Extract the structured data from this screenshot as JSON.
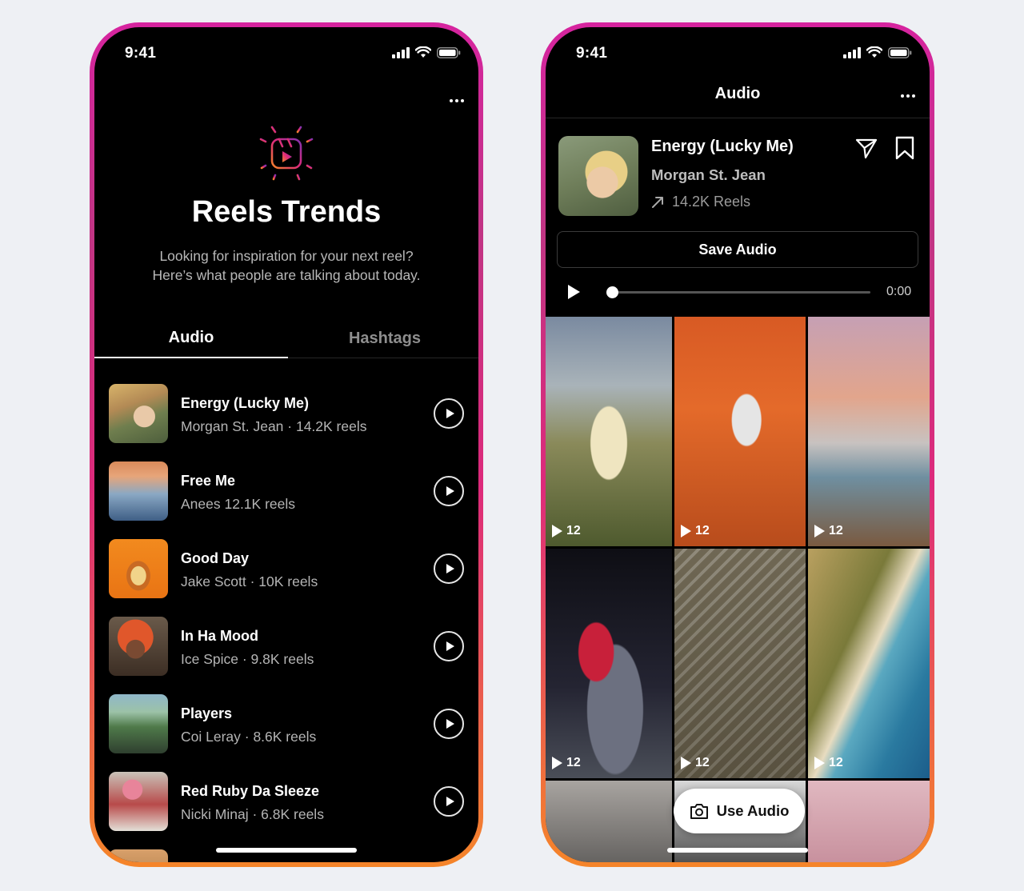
{
  "left_phone": {
    "status_time": "9:41",
    "title": "Reels Trends",
    "subtitle_line1": "Looking for inspiration for your next reel?",
    "subtitle_line2": "Here’s what people are talking about today.",
    "tabs": [
      {
        "label": "Audio",
        "active": true
      },
      {
        "label": "Hashtags",
        "active": false
      }
    ],
    "tracks": [
      {
        "title": "Energy (Lucky Me)",
        "meta": "Morgan St. Jean · 14.2K reels"
      },
      {
        "title": "Free Me",
        "meta": "Anees 12.1K reels"
      },
      {
        "title": "Good Day",
        "meta": "Jake Scott · 10K reels"
      },
      {
        "title": "In Ha Mood",
        "meta": "Ice Spice · 9.8K reels"
      },
      {
        "title": "Players",
        "meta": "Coi Leray · 8.6K reels"
      },
      {
        "title": "Red Ruby Da Sleeze",
        "meta": "Nicki Minaj · 6.8K reels"
      }
    ]
  },
  "right_phone": {
    "status_time": "9:41",
    "header_title": "Audio",
    "audio": {
      "title": "Energy (Lucky Me)",
      "artist": "Morgan St. Jean",
      "reel_count": "14.2K Reels"
    },
    "save_audio_label": "Save Audio",
    "player": {
      "time": "0:00",
      "progress": 0
    },
    "reels": [
      {
        "plays": "12"
      },
      {
        "plays": "12"
      },
      {
        "plays": "12"
      },
      {
        "plays": "12"
      },
      {
        "plays": "12"
      },
      {
        "plays": "12"
      }
    ],
    "use_audio_label": "Use Audio"
  },
  "colors": {
    "gradient_start": "#f58529",
    "gradient_mid": "#dd2a7b",
    "gradient_end": "#c13584",
    "background": "#eef0f4",
    "screen": "#000000"
  }
}
